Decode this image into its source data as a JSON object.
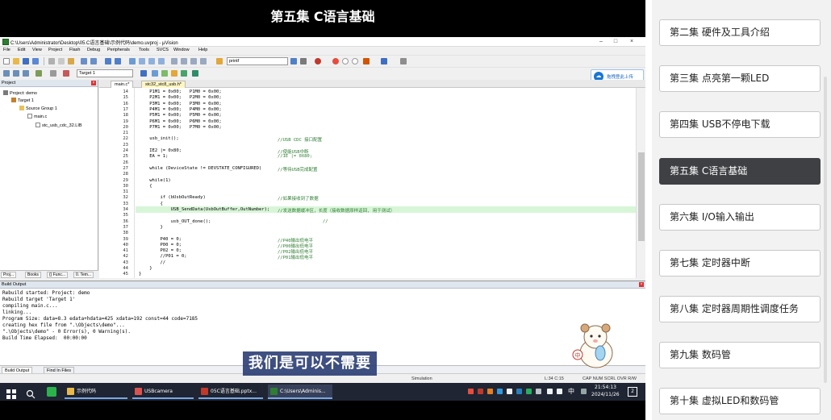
{
  "video": {
    "title": "第五集 C语言基础",
    "subtitle": "我们是可以不需要"
  },
  "ide": {
    "window_title": "C:\\Users\\Administrator\\Desktop\\05.C语言基础\\示例代码\\demo.uvproj - μVision",
    "menu": [
      "File",
      "Edit",
      "View",
      "Project",
      "Flash",
      "Debug",
      "Peripherals",
      "Tools",
      "SVCS",
      "Window",
      "Help"
    ],
    "toolbar_search": "printf",
    "target_select": "Target 1",
    "upload_button": "拖拽登此上传",
    "project_panel": {
      "title": "Project",
      "tree": [
        "Project: demo",
        "Target 1",
        "Source Group 1",
        "main.c",
        "stc_usb_cdc_32.LIB"
      ],
      "tabs": [
        "Proj...",
        "Books",
        "{} Func...",
        "0. Tem..."
      ]
    },
    "editor_tabs": [
      "main.c*",
      "stc32_stc8_usb.h*"
    ],
    "code_lines": [
      {
        "n": "14",
        "code": "    P1M1 = 0x00;   P1M0 = 0x00;",
        "comment": ""
      },
      {
        "n": "15",
        "code": "    P2M1 = 0x00;   P2M0 = 0x00;",
        "comment": ""
      },
      {
        "n": "16",
        "code": "    P3M1 = 0x00;   P3M0 = 0x00;",
        "comment": ""
      },
      {
        "n": "17",
        "code": "    P4M1 = 0x00;   P4M0 = 0x00;",
        "comment": ""
      },
      {
        "n": "18",
        "code": "    P5M1 = 0x00;   P5M0 = 0x00;",
        "comment": ""
      },
      {
        "n": "19",
        "code": "    P6M1 = 0x00;   P6M0 = 0x00;",
        "comment": ""
      },
      {
        "n": "20",
        "code": "    P7M1 = 0x00;   P7M0 = 0x00;",
        "comment": ""
      },
      {
        "n": "21",
        "code": "",
        "comment": ""
      },
      {
        "n": "22",
        "code": "    usb_init();",
        "comment": "//USB CDC 接口配置"
      },
      {
        "n": "23",
        "code": "",
        "comment": ""
      },
      {
        "n": "24",
        "code": "    IE2 |= 0x80;",
        "comment": "//使能USB中断"
      },
      {
        "n": "25",
        "code": "    EA = 1;",
        "comment": "//IE |= 0X80;"
      },
      {
        "n": "26",
        "code": "",
        "comment": ""
      },
      {
        "n": "27",
        "code": "    while (DeviceState != DEVSTATE_CONFIGURED)",
        "comment": "//等待USB完成配置"
      },
      {
        "n": "28",
        "code": "",
        "comment": ""
      },
      {
        "n": "29",
        "code": "    while(1)",
        "comment": ""
      },
      {
        "n": "30",
        "code": "    {",
        "comment": ""
      },
      {
        "n": "31",
        "code": "",
        "comment": ""
      },
      {
        "n": "32",
        "code": "        if (bUsbOutReady)",
        "comment": "//如果接收到了数据"
      },
      {
        "n": "33",
        "code": "        {",
        "comment": ""
      },
      {
        "n": "34",
        "code": "            USB_SendData(UsbOutBuffer,OutNumber);",
        "comment": "//发送数据缓冲区，长度（接收数据原样返回, 用于测试）"
      },
      {
        "n": "35",
        "code": "",
        "comment": ""
      },
      {
        "n": "36",
        "code": "            usb_OUT_done();",
        "comment": "//"
      },
      {
        "n": "37",
        "code": "        }",
        "comment": ""
      },
      {
        "n": "38",
        "code": "",
        "comment": ""
      },
      {
        "n": "39",
        "code": "        P40 = 0;",
        "comment": "//P40输出低电平"
      },
      {
        "n": "40",
        "code": "        P00 = 0;",
        "comment": "//P00输出低电平"
      },
      {
        "n": "41",
        "code": "        P02 = 0;",
        "comment": "//P02输出低电平"
      },
      {
        "n": "42",
        "code": "        //P01 = 0;",
        "comment": "//P01输出低电平"
      },
      {
        "n": "43",
        "code": "        //",
        "comment": ""
      },
      {
        "n": "44",
        "code": "    }",
        "comment": ""
      },
      {
        "n": "45",
        "code": "}",
        "comment": ""
      }
    ],
    "build_panel": {
      "title": "Build Output",
      "log": [
        "Rebuild started: Project: demo",
        "Rebuild target 'Target 1'",
        "compiling main.c...",
        "linking...",
        "Program Size: data=8.3 edata+hdata=425 xdata=192 const=44 code=7185",
        "creating hex file from \".\\Objects\\demo\"...",
        "\".\\Objects\\demo\" - 0 Error(s), 0 Warning(s).",
        "Build Time Elapsed:  00:00:00"
      ],
      "tabs": [
        "Build Output",
        "Find In Files"
      ]
    },
    "status": {
      "mode": "Simulation",
      "position": "L:34 C:15",
      "indicators": "CAP  NUM  SCRL  OVR  R/W"
    }
  },
  "taskbar": {
    "tasks": [
      "示例代码",
      "USBcamera",
      "05C语言基础.pptx...",
      "C:\\Users\\Adminis..."
    ],
    "time": "21:54:13",
    "date": "2024/11/26",
    "ime": "中",
    "notify_count": "2"
  },
  "playlist": {
    "episodes": [
      {
        "label": "第二集 硬件及工具介绍",
        "active": false
      },
      {
        "label": "第三集 点亮第一颗LED",
        "active": false
      },
      {
        "label": "第四集 USB不停电下载",
        "active": false
      },
      {
        "label": "第五集 C语言基础",
        "active": true
      },
      {
        "label": "第六集 I/O输入输出",
        "active": false
      },
      {
        "label": "第七集 定时器中断",
        "active": false
      },
      {
        "label": "第八集 定时器周期性调度任务",
        "active": false
      },
      {
        "label": "第九集 数码管",
        "active": false
      },
      {
        "label": "第十集 虚拟LED和数码管",
        "active": false
      }
    ]
  },
  "colors": {
    "active_episode": "#3e4044",
    "code_comment": "#2e7d32",
    "current_line": "#d8f5d8",
    "subtitle_bg": "#243870"
  }
}
